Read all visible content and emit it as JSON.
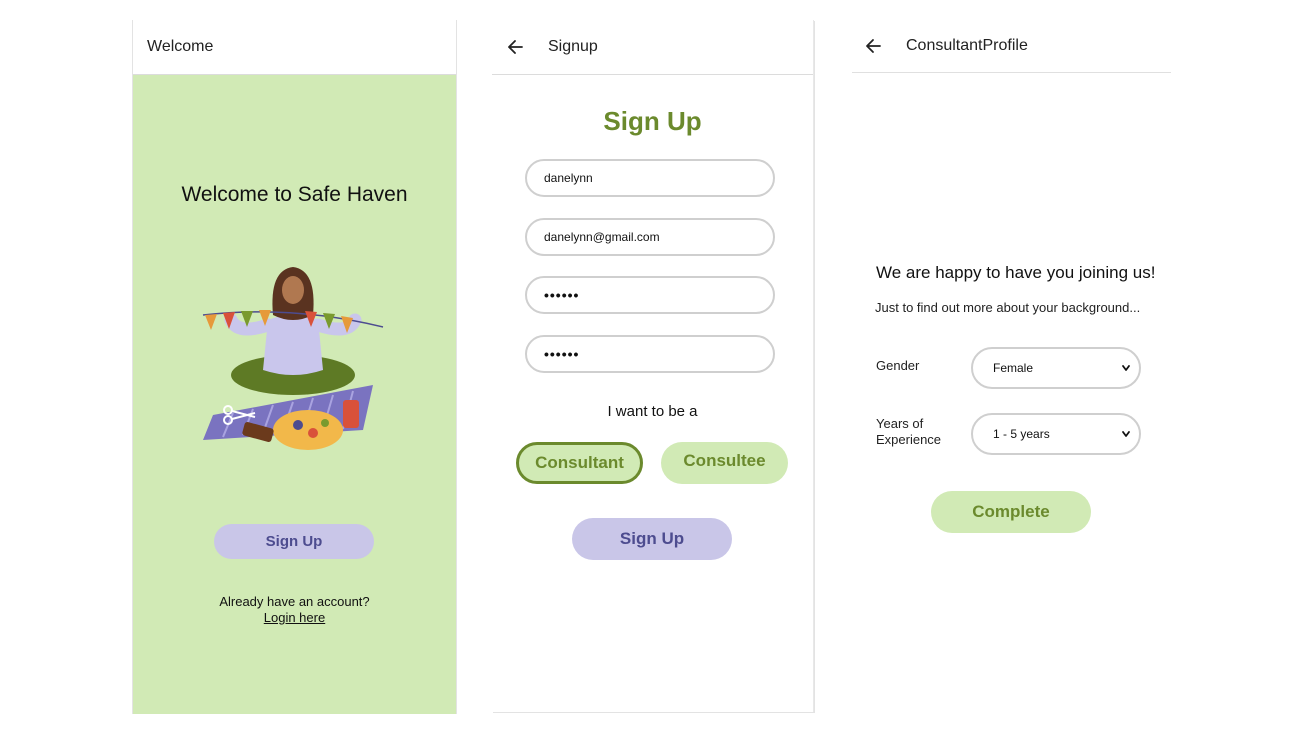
{
  "welcome_screen": {
    "header_title": "Welcome",
    "heading": "Welcome to Safe Haven",
    "signup_label": "Sign Up",
    "account_prompt": "Already have an account?",
    "login_link": "Login here",
    "bg_color": "#d1eab5"
  },
  "signup_screen": {
    "header_title": "Signup",
    "heading": "Sign Up",
    "fields": {
      "username": "danelynn",
      "email": "danelynn@gmail.com",
      "password": "••••••",
      "confirm_password": "••••••"
    },
    "role_prompt": "I want to be a",
    "roles": {
      "consultant": "Consultant",
      "consultee": "Consultee",
      "selected": "Consultant"
    },
    "signup_label": "Sign Up"
  },
  "profile_screen": {
    "header_title": "ConsultantProfile",
    "heading": "We are happy to have you joining us!",
    "subheading": "Just to find out more about your background...",
    "gender_label": "Gender",
    "gender_value": "Female",
    "experience_label_line1": "Years of",
    "experience_label_line2": "Experience",
    "experience_value": "1 - 5 years",
    "complete_label": "Complete"
  },
  "colors": {
    "accent_green": "#6b8a2d",
    "light_green": "#d1eab5",
    "lavender": "#c9c6e8",
    "lavender_text": "#4d4c8f"
  },
  "icons": [
    "back-arrow-icon",
    "chevron-down-icon"
  ]
}
